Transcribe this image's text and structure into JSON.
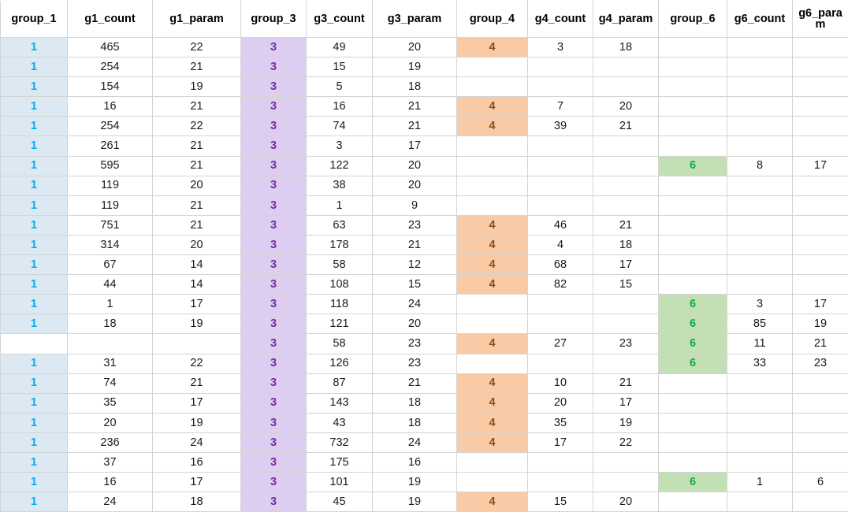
{
  "table": {
    "columns": [
      {
        "key": "group_1",
        "label": "group_1",
        "kind": "group",
        "group": "g1"
      },
      {
        "key": "g1_count",
        "label": "g1_count",
        "kind": "value"
      },
      {
        "key": "g1_param",
        "label": "g1_param",
        "kind": "value"
      },
      {
        "key": "group_3",
        "label": "group_3",
        "kind": "group",
        "group": "g3"
      },
      {
        "key": "g3_count",
        "label": "g3_count",
        "kind": "value"
      },
      {
        "key": "g3_param",
        "label": "g3_param",
        "kind": "value"
      },
      {
        "key": "group_4",
        "label": "group_4",
        "kind": "group",
        "group": "g4"
      },
      {
        "key": "g4_count",
        "label": "g4_count",
        "kind": "value"
      },
      {
        "key": "g4_param",
        "label": "g4_param",
        "kind": "value"
      },
      {
        "key": "group_6",
        "label": "group_6",
        "kind": "group",
        "group": "g6"
      },
      {
        "key": "g6_count",
        "label": "g6_count",
        "kind": "value"
      },
      {
        "key": "g6_param",
        "label": "g6_param",
        "kind": "value"
      }
    ],
    "colors": {
      "group_1_fill": "#dce9f3",
      "group_1_text": "#00aeef",
      "group_3_fill": "#ddcdf0",
      "group_3_text": "#7030a0",
      "group_4_fill": "#f8cba6",
      "group_4_text": "#8a4b18",
      "group_6_fill": "#c3e0b4",
      "group_6_text": "#17a84a",
      "grid_line": "#d4d4d4",
      "header_text": "#000000",
      "cell_text": "#1a1a1a"
    },
    "rows": [
      {
        "group_1": "1",
        "g1_count": "465",
        "g1_param": "22",
        "group_3": "3",
        "g3_count": "49",
        "g3_param": "20",
        "group_4": "4",
        "g4_count": "3",
        "g4_param": "18",
        "group_6": "",
        "g6_count": "",
        "g6_param": ""
      },
      {
        "group_1": "1",
        "g1_count": "254",
        "g1_param": "21",
        "group_3": "3",
        "g3_count": "15",
        "g3_param": "19",
        "group_4": "",
        "g4_count": "",
        "g4_param": "",
        "group_6": "",
        "g6_count": "",
        "g6_param": ""
      },
      {
        "group_1": "1",
        "g1_count": "154",
        "g1_param": "19",
        "group_3": "3",
        "g3_count": "5",
        "g3_param": "18",
        "group_4": "",
        "g4_count": "",
        "g4_param": "",
        "group_6": "",
        "g6_count": "",
        "g6_param": ""
      },
      {
        "group_1": "1",
        "g1_count": "16",
        "g1_param": "21",
        "group_3": "3",
        "g3_count": "16",
        "g3_param": "21",
        "group_4": "4",
        "g4_count": "7",
        "g4_param": "20",
        "group_6": "",
        "g6_count": "",
        "g6_param": ""
      },
      {
        "group_1": "1",
        "g1_count": "254",
        "g1_param": "22",
        "group_3": "3",
        "g3_count": "74",
        "g3_param": "21",
        "group_4": "4",
        "g4_count": "39",
        "g4_param": "21",
        "group_6": "",
        "g6_count": "",
        "g6_param": ""
      },
      {
        "group_1": "1",
        "g1_count": "261",
        "g1_param": "21",
        "group_3": "3",
        "g3_count": "3",
        "g3_param": "17",
        "group_4": "",
        "g4_count": "",
        "g4_param": "",
        "group_6": "",
        "g6_count": "",
        "g6_param": ""
      },
      {
        "group_1": "1",
        "g1_count": "595",
        "g1_param": "21",
        "group_3": "3",
        "g3_count": "122",
        "g3_param": "20",
        "group_4": "",
        "g4_count": "",
        "g4_param": "",
        "group_6": "6",
        "g6_count": "8",
        "g6_param": "17"
      },
      {
        "group_1": "1",
        "g1_count": "119",
        "g1_param": "20",
        "group_3": "3",
        "g3_count": "38",
        "g3_param": "20",
        "group_4": "",
        "g4_count": "",
        "g4_param": "",
        "group_6": "",
        "g6_count": "",
        "g6_param": ""
      },
      {
        "group_1": "1",
        "g1_count": "119",
        "g1_param": "21",
        "group_3": "3",
        "g3_count": "1",
        "g3_param": "9",
        "group_4": "",
        "g4_count": "",
        "g4_param": "",
        "group_6": "",
        "g6_count": "",
        "g6_param": ""
      },
      {
        "group_1": "1",
        "g1_count": "751",
        "g1_param": "21",
        "group_3": "3",
        "g3_count": "63",
        "g3_param": "23",
        "group_4": "4",
        "g4_count": "46",
        "g4_param": "21",
        "group_6": "",
        "g6_count": "",
        "g6_param": ""
      },
      {
        "group_1": "1",
        "g1_count": "314",
        "g1_param": "20",
        "group_3": "3",
        "g3_count": "178",
        "g3_param": "21",
        "group_4": "4",
        "g4_count": "4",
        "g4_param": "18",
        "group_6": "",
        "g6_count": "",
        "g6_param": ""
      },
      {
        "group_1": "1",
        "g1_count": "67",
        "g1_param": "14",
        "group_3": "3",
        "g3_count": "58",
        "g3_param": "12",
        "group_4": "4",
        "g4_count": "68",
        "g4_param": "17",
        "group_6": "",
        "g6_count": "",
        "g6_param": ""
      },
      {
        "group_1": "1",
        "g1_count": "44",
        "g1_param": "14",
        "group_3": "3",
        "g3_count": "108",
        "g3_param": "15",
        "group_4": "4",
        "g4_count": "82",
        "g4_param": "15",
        "group_6": "",
        "g6_count": "",
        "g6_param": ""
      },
      {
        "group_1": "1",
        "g1_count": "1",
        "g1_param": "17",
        "group_3": "3",
        "g3_count": "118",
        "g3_param": "24",
        "group_4": "",
        "g4_count": "",
        "g4_param": "",
        "group_6": "6",
        "g6_count": "3",
        "g6_param": "17"
      },
      {
        "group_1": "1",
        "g1_count": "18",
        "g1_param": "19",
        "group_3": "3",
        "g3_count": "121",
        "g3_param": "20",
        "group_4": "",
        "g4_count": "",
        "g4_param": "",
        "group_6": "6",
        "g6_count": "85",
        "g6_param": "19"
      },
      {
        "group_1": "",
        "g1_count": "",
        "g1_param": "",
        "group_3": "3",
        "g3_count": "58",
        "g3_param": "23",
        "group_4": "4",
        "g4_count": "27",
        "g4_param": "23",
        "group_6": "6",
        "g6_count": "11",
        "g6_param": "21"
      },
      {
        "group_1": "1",
        "g1_count": "31",
        "g1_param": "22",
        "group_3": "3",
        "g3_count": "126",
        "g3_param": "23",
        "group_4": "",
        "g4_count": "",
        "g4_param": "",
        "group_6": "6",
        "g6_count": "33",
        "g6_param": "23"
      },
      {
        "group_1": "1",
        "g1_count": "74",
        "g1_param": "21",
        "group_3": "3",
        "g3_count": "87",
        "g3_param": "21",
        "group_4": "4",
        "g4_count": "10",
        "g4_param": "21",
        "group_6": "",
        "g6_count": "",
        "g6_param": ""
      },
      {
        "group_1": "1",
        "g1_count": "35",
        "g1_param": "17",
        "group_3": "3",
        "g3_count": "143",
        "g3_param": "18",
        "group_4": "4",
        "g4_count": "20",
        "g4_param": "17",
        "group_6": "",
        "g6_count": "",
        "g6_param": ""
      },
      {
        "group_1": "1",
        "g1_count": "20",
        "g1_param": "19",
        "group_3": "3",
        "g3_count": "43",
        "g3_param": "18",
        "group_4": "4",
        "g4_count": "35",
        "g4_param": "19",
        "group_6": "",
        "g6_count": "",
        "g6_param": ""
      },
      {
        "group_1": "1",
        "g1_count": "236",
        "g1_param": "24",
        "group_3": "3",
        "g3_count": "732",
        "g3_param": "24",
        "group_4": "4",
        "g4_count": "17",
        "g4_param": "22",
        "group_6": "",
        "g6_count": "",
        "g6_param": ""
      },
      {
        "group_1": "1",
        "g1_count": "37",
        "g1_param": "16",
        "group_3": "3",
        "g3_count": "175",
        "g3_param": "16",
        "group_4": "",
        "g4_count": "",
        "g4_param": "",
        "group_6": "",
        "g6_count": "",
        "g6_param": ""
      },
      {
        "group_1": "1",
        "g1_count": "16",
        "g1_param": "17",
        "group_3": "3",
        "g3_count": "101",
        "g3_param": "19",
        "group_4": "",
        "g4_count": "",
        "g4_param": "",
        "group_6": "6",
        "g6_count": "1",
        "g6_param": "6"
      },
      {
        "group_1": "1",
        "g1_count": "24",
        "g1_param": "18",
        "group_3": "3",
        "g3_count": "45",
        "g3_param": "19",
        "group_4": "4",
        "g4_count": "15",
        "g4_param": "20",
        "group_6": "",
        "g6_count": "",
        "g6_param": ""
      }
    ]
  }
}
